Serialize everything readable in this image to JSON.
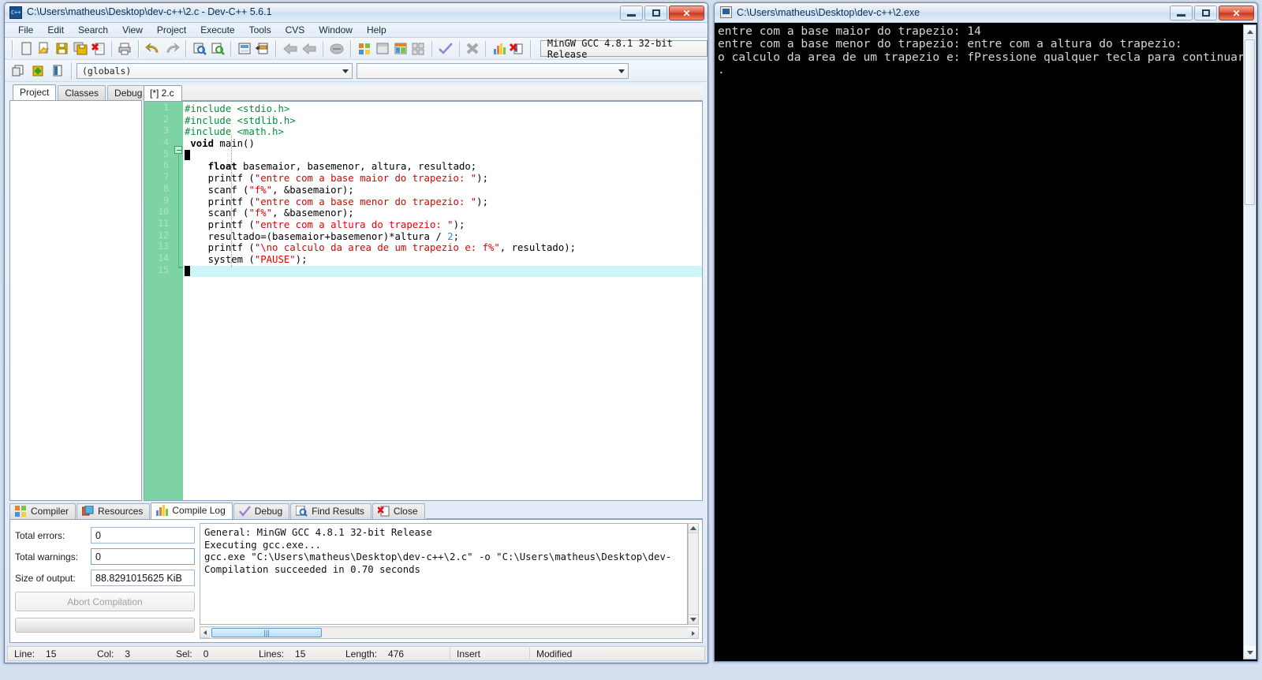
{
  "ide": {
    "title": "C:\\Users\\matheus\\Desktop\\dev-c++\\2.c - Dev-C++ 5.6.1",
    "app_icon": "devcpp-icon",
    "window_buttons": {
      "minimize": "minimize-button",
      "maximize": "maximize-button",
      "close": "close-button"
    },
    "menu": [
      "File",
      "Edit",
      "Search",
      "View",
      "Project",
      "Execute",
      "Tools",
      "CVS",
      "Window",
      "Help"
    ],
    "toolbar_icons_row1": [
      "new-file-icon",
      "open-file-icon",
      "save-icon",
      "save-all-icon",
      "close-file-icon",
      "print-icon",
      "undo-icon",
      "redo-icon",
      "find-icon",
      "replace-icon",
      "goto-line-icon",
      "goto-function-icon",
      "back-icon",
      "forward-icon",
      "toggle-icon",
      "compile-icon",
      "run-icon",
      "compile-run-icon",
      "rebuild-icon",
      "syntax-check-icon",
      "stop-icon",
      "profile-icon",
      "debug-icon"
    ],
    "toolbar_icons_row2": [
      "new-project-icon",
      "add-to-project-icon",
      "remove-from-project-icon"
    ],
    "compiler_set": "MinGW GCC 4.8.1 32-bit Release",
    "globals_combo": "(globals)",
    "members_combo": "",
    "left_tabs": [
      {
        "label": "Project",
        "active": true
      },
      {
        "label": "Classes",
        "active": false
      },
      {
        "label": "Debug",
        "active": false
      }
    ],
    "editor_tab": "[*] 2.c",
    "code_lines": [
      {
        "n": 1,
        "tokens": [
          {
            "t": "pre",
            "s": "#include <stdio.h>"
          }
        ]
      },
      {
        "n": 2,
        "tokens": [
          {
            "t": "pre",
            "s": "#include <stdlib.h>"
          }
        ]
      },
      {
        "n": 3,
        "tokens": [
          {
            "t": "pre",
            "s": "#include <math.h>"
          }
        ]
      },
      {
        "n": 4,
        "tokens": [
          {
            "t": "id",
            "s": " "
          },
          {
            "t": "kw",
            "s": "void"
          },
          {
            "t": "id",
            "s": " main()"
          }
        ]
      },
      {
        "n": 5,
        "tokens": [
          {
            "t": "caret",
            "s": ""
          }
        ]
      },
      {
        "n": 6,
        "tokens": [
          {
            "t": "id",
            "s": "    "
          },
          {
            "t": "kw",
            "s": "float"
          },
          {
            "t": "id",
            "s": " basemaior, basemenor, altura, resultado;"
          }
        ]
      },
      {
        "n": 7,
        "tokens": [
          {
            "t": "id",
            "s": "    printf ("
          },
          {
            "t": "str",
            "s": "\"entre com a base maior do trapezio: \""
          },
          {
            "t": "id",
            "s": ");"
          }
        ]
      },
      {
        "n": 8,
        "tokens": [
          {
            "t": "id",
            "s": "    scanf ("
          },
          {
            "t": "str",
            "s": "\"f%\""
          },
          {
            "t": "id",
            "s": ", &basemaior);"
          }
        ]
      },
      {
        "n": 9,
        "tokens": [
          {
            "t": "id",
            "s": "    printf ("
          },
          {
            "t": "str",
            "s": "\"entre com a base menor do trapezio: \""
          },
          {
            "t": "id",
            "s": ");"
          }
        ]
      },
      {
        "n": 10,
        "tokens": [
          {
            "t": "id",
            "s": "    scanf ("
          },
          {
            "t": "str",
            "s": "\"f%\""
          },
          {
            "t": "id",
            "s": ", &basemenor);"
          }
        ]
      },
      {
        "n": 11,
        "tokens": [
          {
            "t": "id",
            "s": "    printf ("
          },
          {
            "t": "str",
            "s": "\"entre com a altura do trapezio: \""
          },
          {
            "t": "id",
            "s": ");"
          }
        ]
      },
      {
        "n": 12,
        "tokens": [
          {
            "t": "id",
            "s": "    resultado=(basemaior+basemenor)*altura / "
          },
          {
            "t": "num",
            "s": "2"
          },
          {
            "t": "id",
            "s": ";"
          }
        ]
      },
      {
        "n": 13,
        "tokens": [
          {
            "t": "id",
            "s": "    printf ("
          },
          {
            "t": "str",
            "s": "\"\\no calculo da area de um trapezio e: f%\""
          },
          {
            "t": "id",
            "s": ", resultado);"
          }
        ]
      },
      {
        "n": 14,
        "tokens": [
          {
            "t": "id",
            "s": "    system ("
          },
          {
            "t": "str",
            "s": "\"PAUSE\""
          },
          {
            "t": "id",
            "s": ");"
          }
        ]
      },
      {
        "n": 15,
        "tokens": [
          {
            "t": "caret",
            "s": ""
          }
        ],
        "highlight": true
      }
    ],
    "bottom_tabs": [
      {
        "label": "Compiler",
        "icon": "compiler-icon",
        "active": false
      },
      {
        "label": "Resources",
        "icon": "resources-icon",
        "active": false
      },
      {
        "label": "Compile Log",
        "icon": "compile-log-icon",
        "active": true
      },
      {
        "label": "Debug",
        "icon": "debug-check-icon",
        "active": false
      },
      {
        "label": "Find Results",
        "icon": "find-results-icon",
        "active": false
      },
      {
        "label": "Close",
        "icon": "close-panel-icon",
        "active": false
      }
    ],
    "compile_log": {
      "total_errors_label": "Total errors:",
      "total_errors": "0",
      "total_warnings_label": "Total warnings:",
      "total_warnings": "0",
      "size_of_output_label": "Size of output:",
      "size_of_output": "88.8291015625 KiB",
      "abort_button": "Abort Compilation",
      "log_text": "General: MinGW GCC 4.8.1 32-bit Release\nExecuting gcc.exe...\ngcc.exe \"C:\\Users\\matheus\\Desktop\\dev-c++\\2.c\" -o \"C:\\Users\\matheus\\Desktop\\dev-\nCompilation succeeded in 0.70 seconds"
    },
    "status_bar": {
      "line_label": "Line:",
      "line": "15",
      "col_label": "Col:",
      "col": "3",
      "sel_label": "Sel:",
      "sel": "0",
      "lines_label": "Lines:",
      "lines": "15",
      "length_label": "Length:",
      "length": "476",
      "insert_mode": "Insert",
      "modified": "Modified"
    }
  },
  "console": {
    "title": "C:\\Users\\matheus\\Desktop\\dev-c++\\2.exe",
    "icon": "console-app-icon",
    "window_buttons": {
      "minimize": "minimize-button",
      "maximize": "maximize-button",
      "close": "close-button"
    },
    "output": "entre com a base maior do trapezio: 14\nentre com a base menor do trapezio: entre com a altura do trapezio:\no calculo da area de um trapezio e: fPressione qualquer tecla para continuar. .\n."
  },
  "colors": {
    "preprocessor": "#0b8a3c",
    "string": "#e00000",
    "number": "#2d8cc8",
    "gutter_bg": "#7ed3a4",
    "current_line": "#cdf5f7",
    "console_bg": "#000000",
    "console_fg": "#d6d6d6"
  }
}
